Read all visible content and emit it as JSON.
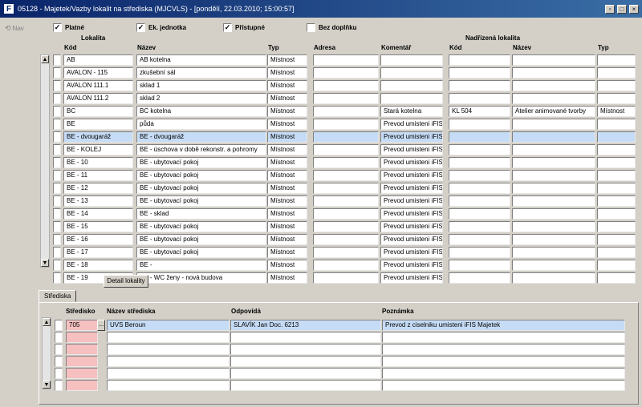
{
  "window": {
    "title": "05128 - Majetek/Vazby lokalit na střediska (MJCVLS) - [pondělí, 22.03.2010; 15:00:57]",
    "app_icon": "F",
    "buttons": [
      "▫",
      "□",
      "×"
    ]
  },
  "sidebar": {
    "nav_label": "Nav",
    "nav_icon": "⟲"
  },
  "filters": [
    {
      "label": "Platné",
      "checked": "✓"
    },
    {
      "label": "Ek. jednotka",
      "checked": "✓"
    },
    {
      "label": "Přístupné",
      "checked": "✓"
    },
    {
      "label": "Bez doplňku",
      "checked": ""
    }
  ],
  "lokality": {
    "group_lokalita": "Lokalita",
    "group_nadrizena": "Nadřízená lokalita",
    "headers": {
      "kod": "Kód",
      "nazev": "Název",
      "typ": "Typ",
      "adresa": "Adresa",
      "komentar": "Komentář",
      "n_kod": "Kód",
      "n_nazev": "Název",
      "n_typ": "Typ"
    },
    "rows": [
      {
        "kod": "AB",
        "nazev": "AB kotelna",
        "typ": "Místnost",
        "adresa": "",
        "komentar": "",
        "n_kod": "",
        "n_nazev": "",
        "n_typ": ""
      },
      {
        "kod": "AVALON - 115",
        "nazev": "zkušební sál",
        "typ": "Místnost",
        "adresa": "",
        "komentar": "",
        "n_kod": "",
        "n_nazev": "",
        "n_typ": ""
      },
      {
        "kod": "AVALON 111.1",
        "nazev": "sklad 1",
        "typ": "Místnost",
        "adresa": "",
        "komentar": "",
        "n_kod": "",
        "n_nazev": "",
        "n_typ": ""
      },
      {
        "kod": "AVALON 111.2",
        "nazev": "sklad 2",
        "typ": "Místnost",
        "adresa": "",
        "komentar": "",
        "n_kod": "",
        "n_nazev": "",
        "n_typ": ""
      },
      {
        "kod": "BC",
        "nazev": "BC kotelna",
        "typ": "Místnost",
        "adresa": "",
        "komentar": "Stará kotelna",
        "n_kod": "KL 504",
        "n_nazev": "Atelier animované tvorby",
        "n_typ": "Místnost"
      },
      {
        "kod": "BE",
        "nazev": "půda",
        "typ": "Místnost",
        "adresa": "",
        "komentar": "Prevod umisteni iFIS",
        "n_kod": "",
        "n_nazev": "",
        "n_typ": ""
      },
      {
        "kod": "BE - dvougaráž",
        "nazev": "BE - dvougaráž",
        "typ": "Místnost",
        "adresa": "",
        "komentar": "Prevod umisteni iFIS",
        "n_kod": "",
        "n_nazev": "",
        "n_typ": "",
        "selected": true
      },
      {
        "kod": "BE - KOLEJ",
        "nazev": "BE - úschova v době rekonstr. a pohromy",
        "typ": "Místnost",
        "adresa": "",
        "komentar": "Prevod umisteni iFIS",
        "n_kod": "",
        "n_nazev": "",
        "n_typ": ""
      },
      {
        "kod": "BE - 10",
        "nazev": "BE - ubytovací pokoj",
        "typ": "Místnost",
        "adresa": "",
        "komentar": "Prevod umisteni iFIS",
        "n_kod": "",
        "n_nazev": "",
        "n_typ": ""
      },
      {
        "kod": "BE - 11",
        "nazev": "BE - ubytovací pokoj",
        "typ": "Místnost",
        "adresa": "",
        "komentar": "Prevod umisteni iFIS",
        "n_kod": "",
        "n_nazev": "",
        "n_typ": ""
      },
      {
        "kod": "BE - 12",
        "nazev": "BE - ubytovací pokoj",
        "typ": "Místnost",
        "adresa": "",
        "komentar": "Prevod umisteni iFIS",
        "n_kod": "",
        "n_nazev": "",
        "n_typ": ""
      },
      {
        "kod": "BE - 13",
        "nazev": "BE - ubytovací pokoj",
        "typ": "Místnost",
        "adresa": "",
        "komentar": "Prevod umisteni iFIS",
        "n_kod": "",
        "n_nazev": "",
        "n_typ": ""
      },
      {
        "kod": "BE - 14",
        "nazev": "BE - sklad",
        "typ": "Místnost",
        "adresa": "",
        "komentar": "Prevod umisteni iFIS",
        "n_kod": "",
        "n_nazev": "",
        "n_typ": ""
      },
      {
        "kod": "BE - 15",
        "nazev": "BE - ubytovací pokoj",
        "typ": "Místnost",
        "adresa": "",
        "komentar": "Prevod umisteni iFIS",
        "n_kod": "",
        "n_nazev": "",
        "n_typ": ""
      },
      {
        "kod": "BE - 16",
        "nazev": "BE - ubytovací pokoj",
        "typ": "Místnost",
        "adresa": "",
        "komentar": "Prevod umisteni iFIS",
        "n_kod": "",
        "n_nazev": "",
        "n_typ": ""
      },
      {
        "kod": "BE - 17",
        "nazev": "BE - ubytovací pokoj",
        "typ": "Místnost",
        "adresa": "",
        "komentar": "Prevod umisteni iFIS",
        "n_kod": "",
        "n_nazev": "",
        "n_typ": ""
      },
      {
        "kod": "BE - 18",
        "nazev": "BE -",
        "typ": "Místnost",
        "adresa": "",
        "komentar": "Prevod umisteni iFIS",
        "n_kod": "",
        "n_nazev": "",
        "n_typ": ""
      },
      {
        "kod": "BE - 19",
        "nazev": "BE - WC ženy - nová budova",
        "typ": "Místnost",
        "adresa": "",
        "komentar": "Prevod umisteni iFIS",
        "n_kod": "",
        "n_nazev": "",
        "n_typ": ""
      }
    ],
    "detail_button": "Detail lokality"
  },
  "strediska": {
    "tab_label": "Střediska",
    "headers": {
      "stredisko": "Středisko",
      "nazev": "Název střediska",
      "odpovida": "Odpovídá",
      "poznamka": "Poznámka"
    },
    "rows": [
      {
        "stredisko": "705",
        "nazev": "UVS Beroun",
        "odpovida": "SLAVÍK Jan Doc. 6213",
        "poznamka": "Prevod z ciselniku umisteni iFIS Majetek",
        "selected": true
      },
      {
        "stredisko": "",
        "nazev": "",
        "odpovida": "",
        "poznamka": ""
      },
      {
        "stredisko": "",
        "nazev": "",
        "odpovida": "",
        "poznamka": ""
      },
      {
        "stredisko": "",
        "nazev": "",
        "odpovida": "",
        "poznamka": ""
      },
      {
        "stredisko": "",
        "nazev": "",
        "odpovida": "",
        "poznamka": ""
      },
      {
        "stredisko": "",
        "nazev": "",
        "odpovida": "",
        "poznamka": ""
      }
    ],
    "lov_label": "..."
  },
  "scroll": {
    "up": "▲",
    "down": "▼"
  }
}
